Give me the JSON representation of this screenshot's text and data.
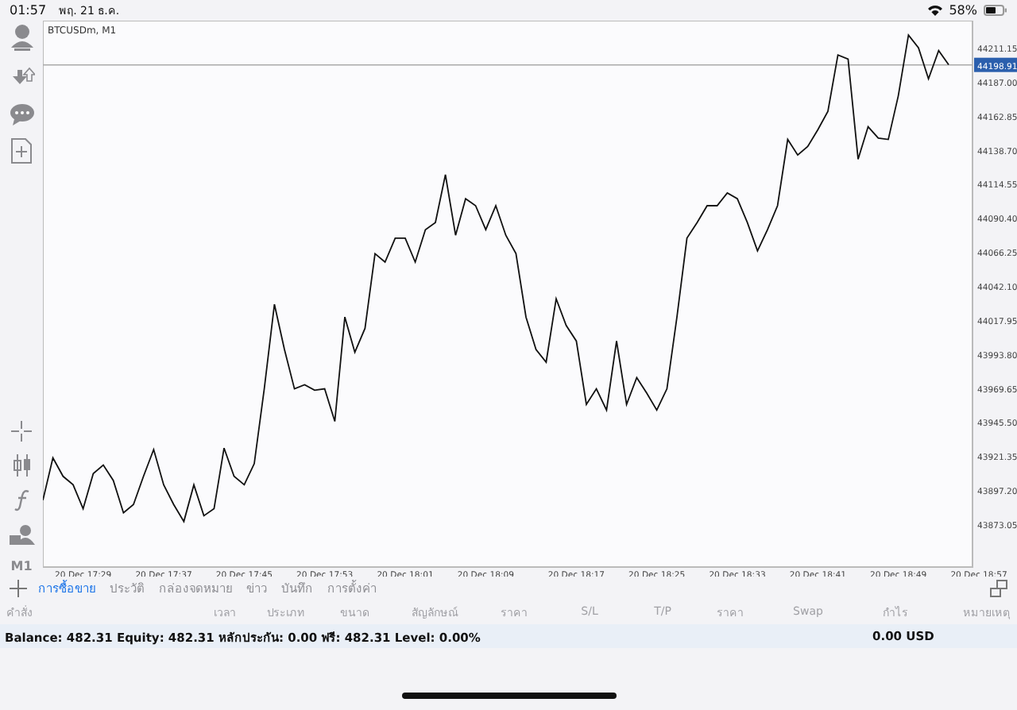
{
  "status_bar": {
    "time": "01:57",
    "date": "พฤ. 21 ธ.ค.",
    "battery": "58%"
  },
  "toolbar": {
    "timeframe": "M1"
  },
  "chart": {
    "symbol": "BTCUSDm, M1",
    "chart_data": {
      "type": "line",
      "ylim": [
        43842.6,
        44230.3
      ],
      "ref_lines": [
        {
          "axis": "y",
          "value": 44198.91,
          "label": "44198.91"
        }
      ],
      "categories": [
        null,
        null,
        null,
        null,
        "20 Dec 17:29",
        null,
        null,
        null,
        null,
        null,
        null,
        null,
        "20 Dec 17:37",
        null,
        null,
        null,
        null,
        null,
        null,
        null,
        "20 Dec 17:45",
        null,
        null,
        null,
        null,
        null,
        null,
        null,
        "20 Dec 17:53",
        null,
        null,
        null,
        null,
        null,
        null,
        null,
        "20 Dec 18:01",
        null,
        null,
        null,
        null,
        null,
        null,
        null,
        "20 Dec 18:09",
        null,
        null,
        null,
        null,
        null,
        null,
        null,
        null,
        "20 Dec 18:17",
        null,
        null,
        null,
        null,
        null,
        null,
        null,
        "20 Dec 18:25",
        null,
        null,
        null,
        null,
        null,
        null,
        null,
        "20 Dec 18:33",
        null,
        null,
        null,
        null,
        null,
        null,
        null,
        "20 Dec 18:41",
        null,
        null,
        null,
        null,
        null,
        null,
        null,
        "20 Dec 18:49",
        null,
        null,
        null,
        null,
        null,
        null,
        null,
        "20 Dec 18:57"
      ],
      "series": [
        {
          "color": "#111111",
          "values": [
            43890,
            43920,
            43907,
            43901,
            43884,
            43909,
            43915,
            43904,
            43881,
            43887,
            43907,
            43926,
            43901,
            43887,
            43875,
            43901,
            43879,
            43884,
            43927,
            43907,
            43901,
            43916,
            43969,
            44029,
            43997,
            43969,
            43972,
            43968,
            43969,
            43946,
            44020,
            43995,
            44012,
            44065,
            44059,
            44076,
            44076,
            44059,
            44082,
            44087,
            44121,
            44078,
            44104,
            44099,
            44082,
            44099,
            44078,
            44065,
            44020,
            43997,
            43988,
            44033,
            44014,
            44003,
            43958,
            43969,
            43954,
            44003,
            43958,
            43977,
            43966,
            43954,
            43969,
            44020,
            44076,
            44087,
            44099,
            44099,
            44108,
            44104,
            44087,
            44067,
            44082,
            44099,
            44146,
            44135,
            44141,
            44153,
            44166,
            44206,
            44203,
            44132,
            44155,
            44147,
            44146,
            44177,
            44220,
            44211,
            44189,
            44209,
            44199,
            null,
            null,
            null
          ]
        }
      ],
      "yticks": [
        {
          "value": 44211.15,
          "label": "44211.15"
        },
        {
          "value": 44187.0,
          "label": "44187.00"
        },
        {
          "value": 44162.85,
          "label": "44162.85"
        },
        {
          "value": 44138.7,
          "label": "44138.70"
        },
        {
          "value": 44114.55,
          "label": "44114.55"
        },
        {
          "value": 44090.4,
          "label": "44090.40"
        },
        {
          "value": 44066.25,
          "label": "44066.25"
        },
        {
          "value": 44042.1,
          "label": "44042.10"
        },
        {
          "value": 44017.95,
          "label": "44017.95"
        },
        {
          "value": 43993.8,
          "label": "43993.80"
        },
        {
          "value": 43969.65,
          "label": "43969.65"
        },
        {
          "value": 43945.5,
          "label": "43945.50"
        },
        {
          "value": 43921.35,
          "label": "43921.35"
        },
        {
          "value": 43897.2,
          "label": "43897.20"
        },
        {
          "value": 43873.05,
          "label": "43873.05"
        }
      ]
    }
  },
  "tabs": [
    {
      "label": "การซื้อขาย",
      "selected": true
    },
    {
      "label": "ประวัติ",
      "selected": false
    },
    {
      "label": "กล่องจดหมาย",
      "selected": false
    },
    {
      "label": "ข่าว",
      "selected": false
    },
    {
      "label": "บันทึก",
      "selected": false
    },
    {
      "label": "การตั้งค่า",
      "selected": false
    }
  ],
  "table": {
    "columns": [
      "คำสั่ง",
      "เวลา",
      "ประเภท",
      "ขนาด",
      "สัญลักษณ์",
      "ราคา",
      "S/L",
      "T/P",
      "ราคา",
      "Swap",
      "กำไร",
      "หมายเหตุ"
    ]
  },
  "summary": {
    "balance": "Balance: 482.31 Equity: 482.31 หลักประกัน: 0.00 ฟรี: 482.31 Level: 0.00%",
    "profit": "0.00  USD"
  }
}
